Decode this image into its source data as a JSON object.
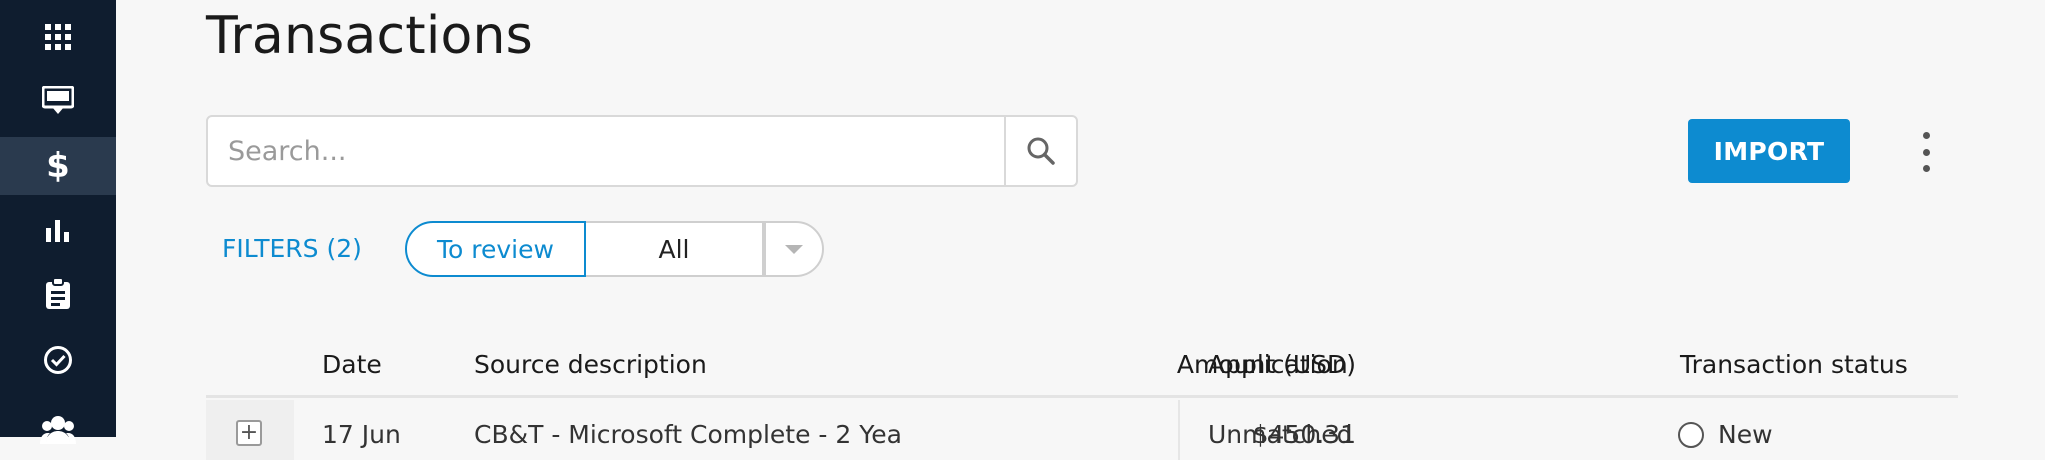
{
  "sidebar": {
    "items": [
      {
        "icon": "grid-icon",
        "active": false
      },
      {
        "icon": "monitor-icon",
        "active": false
      },
      {
        "icon": "dollar-icon",
        "label": "$",
        "active": true
      },
      {
        "icon": "bar-chart-icon",
        "active": false
      },
      {
        "icon": "clipboard-icon",
        "active": false
      },
      {
        "icon": "check-circle-icon",
        "active": false
      },
      {
        "icon": "users-icon",
        "active": false
      }
    ]
  },
  "page": {
    "title": "Transactions"
  },
  "search": {
    "placeholder": "Search..."
  },
  "toolbar": {
    "import_label": "IMPORT"
  },
  "filters": {
    "link_label": "FILTERS (2)",
    "segments": [
      "To review",
      "All"
    ],
    "selected": "To review"
  },
  "table": {
    "columns": {
      "date": "Date",
      "source": "Source description",
      "amount": "Amount (USD)",
      "application": "Application",
      "status": "Transaction status"
    },
    "rows": [
      {
        "expand_label": "+",
        "date": "17 Jun",
        "source": "CB&T - Microsoft Complete - 2 Yea",
        "amount": "$450.31",
        "application": "Unmatched",
        "status": "New"
      }
    ]
  },
  "colors": {
    "sidebar_bg": "#0f1d2f",
    "sidebar_active": "#2a3a4e",
    "accent": "#0d8bd0",
    "page_bg": "#f7f7f7"
  }
}
